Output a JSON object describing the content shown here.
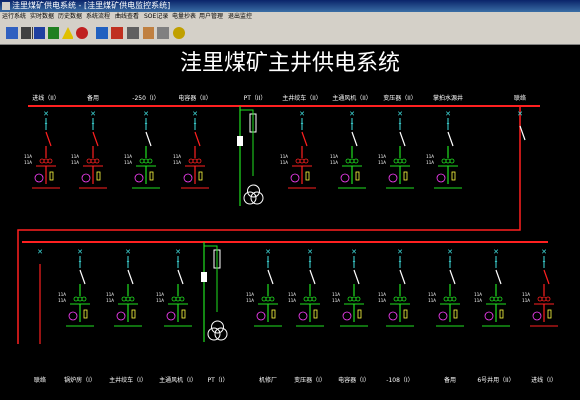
{
  "window": {
    "title": "洼里煤矿供电系统 - [洼里煤矿供电监控系统]"
  },
  "menu": [
    "运行系统",
    "实时数据",
    "历史数据",
    "系统流程",
    "曲线查看",
    "SOE记录",
    "电量抄表",
    "用户管理",
    "退出监控"
  ],
  "toolbar": [
    {
      "icon": "doc-icon",
      "color": "#3060c0"
    },
    {
      "icon": "print-icon",
      "color": "#404040"
    },
    {
      "icon": "save-icon",
      "color": "#2040a0"
    },
    {
      "icon": "network-icon",
      "color": "#208020"
    },
    {
      "icon": "warning-icon",
      "color": "#e0c000"
    },
    {
      "icon": "stop-icon",
      "color": "#c02020"
    },
    {
      "icon": "bar-chart-icon",
      "color": "#2060c0"
    },
    {
      "icon": "curve-icon",
      "color": "#c03020"
    },
    {
      "icon": "report-icon",
      "color": "#606060"
    },
    {
      "icon": "user-icon",
      "color": "#c08040"
    },
    {
      "icon": "exit-icon",
      "color": "#808080"
    },
    {
      "icon": "help-icon",
      "color": "#c0a000"
    }
  ],
  "diagram": {
    "title": "洼里煤矿主井供电系统",
    "top_feeders": [
      {
        "label": "进线（II）",
        "status": "red"
      },
      {
        "label": "备用",
        "status": "red"
      },
      {
        "label": "-250（I）",
        "status": "green"
      },
      {
        "label": "电容器（II）",
        "status": "red"
      },
      {
        "label": "PT（II）",
        "status": "pt"
      },
      {
        "label": "主井绞车（II）",
        "status": "red"
      },
      {
        "label": "主通风机（II）",
        "status": "green"
      },
      {
        "label": "变压器（II）",
        "status": "green"
      },
      {
        "label": "掌拍水源井",
        "status": "green"
      },
      {
        "label": "联络",
        "status": "tie"
      }
    ],
    "bottom_feeders": [
      {
        "label": "联络",
        "status": "tie"
      },
      {
        "label": "锅炉房（I）",
        "status": "green"
      },
      {
        "label": "主井绞车（I）",
        "status": "green"
      },
      {
        "label": "主通风机（I）",
        "status": "green"
      },
      {
        "label": "PT（I）",
        "status": "pt"
      },
      {
        "label": "机修厂",
        "status": "green"
      },
      {
        "label": "变压器（I）",
        "status": "green"
      },
      {
        "label": "电容器（I）",
        "status": "green"
      },
      {
        "label": "-108（I）",
        "status": "green"
      },
      {
        "label": "备用",
        "status": "green"
      },
      {
        "label": "6号井用（II）",
        "status": "green"
      },
      {
        "label": "进线（I）",
        "status": "red"
      }
    ],
    "colors": {
      "live": "#ff2020",
      "off": "#20e020",
      "cyan": "#40e0e0",
      "white": "#ffffff",
      "yellow": "#ffff40",
      "magenta": "#ff40ff"
    }
  }
}
